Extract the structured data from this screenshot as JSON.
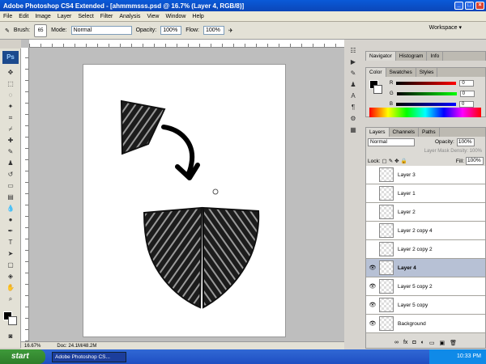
{
  "window": {
    "title": "Adobe Photoshop CS4 Extended - [ahmmmsss.psd @ 16.7% (Layer 4, RGB/8)]"
  },
  "menu": [
    "File",
    "Edit",
    "Image",
    "Layer",
    "Select",
    "Filter",
    "Analysis",
    "View",
    "Window",
    "Help"
  ],
  "options": {
    "brush_label": "Brush:",
    "brush_size": "65",
    "mode_label": "Mode:",
    "mode_value": "Normal",
    "opacity_label": "Opacity:",
    "opacity_value": "100%",
    "flow_label": "Flow:",
    "flow_value": "100%",
    "workspace": "Workspace ▾"
  },
  "toolbox": {
    "logo": "Ps"
  },
  "status": {
    "zoom": "16.67%",
    "doc": "Doc: 24.1M/48.2M"
  },
  "panels": {
    "nav_tabs": [
      "Navigator",
      "Histogram",
      "Info"
    ],
    "color_tabs": [
      "Color",
      "Swatches",
      "Styles"
    ],
    "color": {
      "r_label": "R",
      "g_label": "G",
      "b_label": "B",
      "r": "0",
      "g": "0",
      "b": "0"
    },
    "layers_tabs": [
      "Layers",
      "Channels",
      "Paths"
    ],
    "blend": "Normal",
    "opacity_label": "Opacity:",
    "opacity": "100%",
    "mask_label": "Layer Mask Density:",
    "mask_value": "100%",
    "lock_label": "Lock:",
    "fill_label": "Fill:",
    "fill": "100%"
  },
  "layers": [
    {
      "name": "Layer 3",
      "eye": false,
      "selected": false
    },
    {
      "name": "Layer 1",
      "eye": false,
      "selected": false
    },
    {
      "name": "Layer 2",
      "eye": false,
      "selected": false
    },
    {
      "name": "Layer 2 copy 4",
      "eye": false,
      "selected": false
    },
    {
      "name": "Layer 2 copy 2",
      "eye": false,
      "selected": false
    },
    {
      "name": "Layer 4",
      "eye": true,
      "selected": true
    },
    {
      "name": "Layer 5 copy 2",
      "eye": true,
      "selected": false
    },
    {
      "name": "Layer 5 copy",
      "eye": true,
      "selected": false
    },
    {
      "name": "Background",
      "eye": true,
      "selected": false
    }
  ],
  "taskbar": {
    "start": "start",
    "task": "Adobe Photoshop CS...",
    "clock": "10:33 PM"
  }
}
